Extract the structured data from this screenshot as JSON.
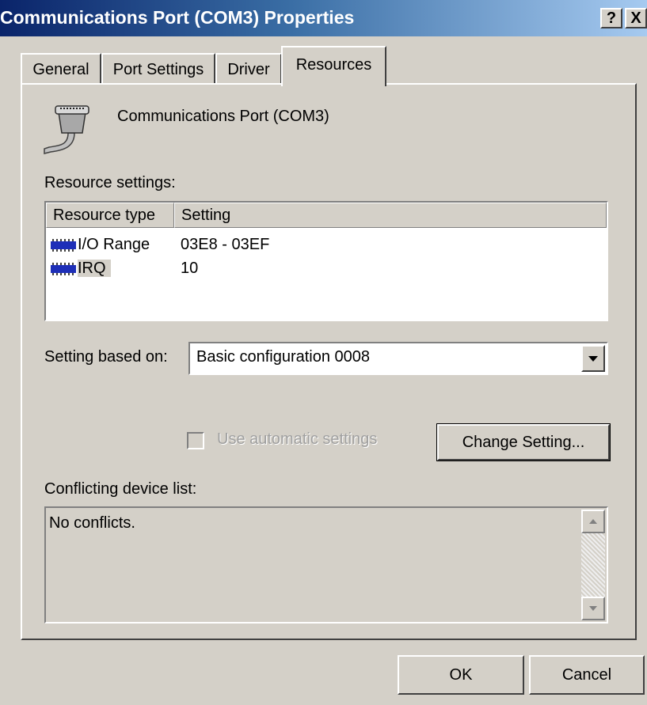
{
  "window": {
    "title": "Communications Port (COM3) Properties",
    "help_label": "?",
    "close_label": "X"
  },
  "tabs": [
    {
      "label": "General",
      "active": false
    },
    {
      "label": "Port Settings",
      "active": false
    },
    {
      "label": "Driver",
      "active": false
    },
    {
      "label": "Resources",
      "active": true
    }
  ],
  "device": {
    "icon": "serial-port-icon",
    "name": "Communications Port (COM3)"
  },
  "resources": {
    "section_label": "Resource settings:",
    "columns": [
      "Resource type",
      "Setting"
    ],
    "rows": [
      {
        "icon": "resource-chip-icon",
        "type": "I/O Range",
        "setting": "03E8 - 03EF",
        "selected": false
      },
      {
        "icon": "resource-chip-icon",
        "type": "IRQ",
        "setting": "10",
        "selected": true
      }
    ]
  },
  "setting_based_on": {
    "label": "Setting based on:",
    "value": "Basic configuration 0008"
  },
  "auto_settings": {
    "label": "Use automatic settings",
    "checked": false,
    "disabled": true
  },
  "change_setting_label": "Change Setting...",
  "conflicts": {
    "label": "Conflicting device list:",
    "text": "No conflicts."
  },
  "buttons": {
    "ok": "OK",
    "cancel": "Cancel"
  },
  "colors": {
    "titlebar_start": "#0a246a",
    "titlebar_end": "#a6caf0",
    "face": "#d4d0c8",
    "chip": "#1e2fb8"
  }
}
